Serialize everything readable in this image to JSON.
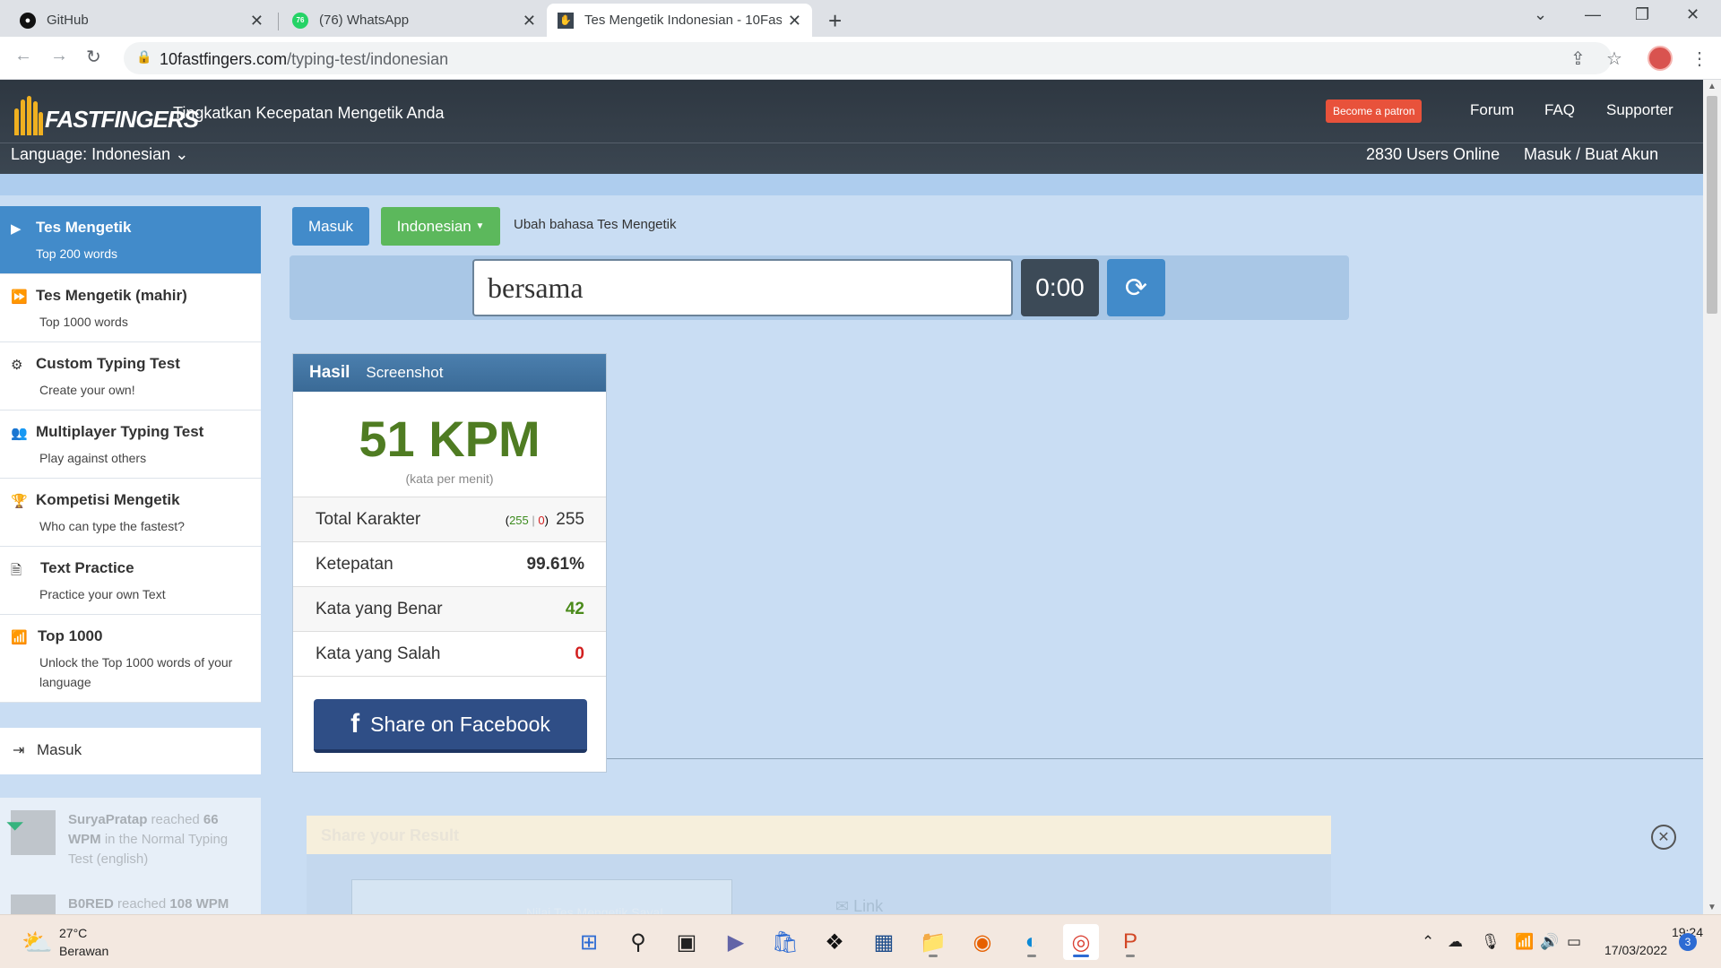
{
  "browser": {
    "tabs": [
      {
        "title": "GitHub",
        "icon": "github-icon"
      },
      {
        "title": "(76) WhatsApp",
        "icon": "whatsapp-icon",
        "badge": "76"
      },
      {
        "title": "Tes Mengetik Indonesian - 10Fas",
        "icon": "10fastfingers-icon"
      }
    ],
    "url_domain": "10fastfingers.com",
    "url_path": "/typing-test/indonesian"
  },
  "header": {
    "logo_text": "FASTFINGERS",
    "tagline": "Tingkatkan Kecepatan Mengetik Anda",
    "patron_label": "Become a patron",
    "nav": [
      "Forum",
      "FAQ",
      "Supporter"
    ],
    "language_label": "Language: Indonesian",
    "users_online": "2830 Users Online",
    "login_link": "Masuk / Buat Akun"
  },
  "sidebar": {
    "items": [
      {
        "title": "Tes Mengetik",
        "subtitle": "Top 200 words",
        "icon": "play-icon",
        "active": true
      },
      {
        "title": "Tes Mengetik (mahir)",
        "subtitle": "Top 1000 words",
        "icon": "forward-icon"
      },
      {
        "title": "Custom Typing Test",
        "subtitle": "Create your own!",
        "icon": "cogs-icon"
      },
      {
        "title": "Multiplayer Typing Test",
        "subtitle": "Play against others",
        "icon": "users-icon"
      },
      {
        "title": "Kompetisi Mengetik",
        "subtitle": "Who can type the fastest?",
        "icon": "trophy-icon"
      },
      {
        "title": "Text Practice",
        "subtitle": "Practice your own Text",
        "icon": "document-icon"
      },
      {
        "title": "Top 1000",
        "subtitle": "Unlock the Top 1000 words of your language",
        "icon": "signal-icon"
      }
    ],
    "login_label": "Masuk",
    "activity": [
      {
        "user": "SuryaPratap",
        "text1": " reached ",
        "wpm": "66",
        "text2": "WPM",
        "rest": " in the Normal Typing Test (english)"
      },
      {
        "user": "B0RED",
        "text1": " reached ",
        "wpm": "108 WPM",
        "text2": "",
        "rest": ""
      }
    ]
  },
  "controls": {
    "login_button": "Masuk",
    "language_button": "Indonesian",
    "change_language_text": "Ubah bahasa Tes Mengetik",
    "current_word": "bersama",
    "timer": "0:00"
  },
  "result": {
    "tab_result": "Hasil",
    "tab_screenshot": "Screenshot",
    "wpm": "51 KPM",
    "wpm_label": "(kata per menit)",
    "rows": {
      "total_label": "Total Karakter",
      "total_correct": "255",
      "total_sep": "|",
      "total_wrong": "0",
      "total_value": "255",
      "accuracy_label": "Ketepatan",
      "accuracy_value": "99.61%",
      "correct_label": "Kata yang Benar",
      "correct_value": "42",
      "wrong_label": "Kata yang Salah",
      "wrong_value": "0"
    },
    "facebook_button": "Share on Facebook"
  },
  "share_overlay": {
    "title": "Share your Result",
    "image_text": "Nilai Tes Mengetik Saya!",
    "link_label": "Link"
  },
  "taskbar": {
    "temperature": "27°C",
    "weather": "Berawan",
    "time": "19:24",
    "date": "17/03/2022",
    "notifications": "3"
  },
  "colors": {
    "accent_blue": "#428bca",
    "green_button": "#5cb85c",
    "wpm_green": "#4f7c22",
    "error_red": "#d21f1f",
    "facebook_blue": "#2f4e86"
  }
}
